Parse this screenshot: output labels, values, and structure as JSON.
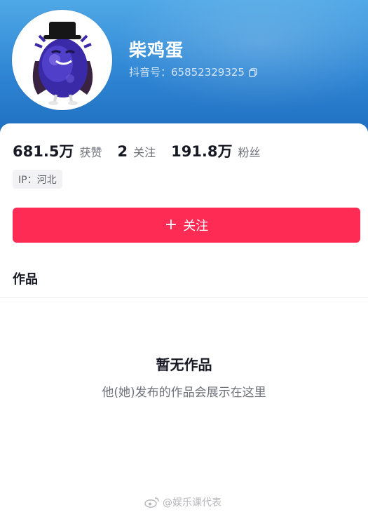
{
  "profile": {
    "nickname": "柴鸡蛋",
    "account_id": "抖音号：65852329325",
    "avatar_icon": "cartoon-eggplant-avatar",
    "copy_icon": "copy-icon"
  },
  "stats": [
    {
      "value": "681.5万",
      "label": "获赞"
    },
    {
      "value": "2",
      "label": "关注"
    },
    {
      "value": "191.8万",
      "label": "粉丝"
    }
  ],
  "ip_tag": "IP：河北",
  "follow_button": {
    "icon": "+",
    "label": "关注"
  },
  "tabs": {
    "works": "作品"
  },
  "empty_state": {
    "title": "暂无作品",
    "subtitle": "他(她)发布的作品会展示在这里"
  },
  "watermark": {
    "text": "@娱乐课代表",
    "icon": "weibo-icon"
  },
  "colors": {
    "accent": "#fe2c55",
    "banner": "#2f86d4"
  }
}
